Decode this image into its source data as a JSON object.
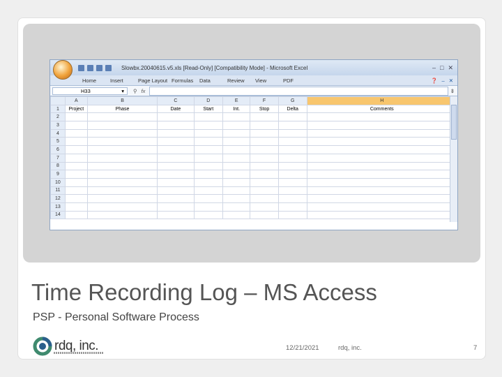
{
  "excel": {
    "window_title": "Slowbx.20040615.v5.xls [Read-Only] [Compatibility Mode] - Microsoft Excel",
    "ribbon_tabs": [
      "Home",
      "Insert",
      "Page Layout",
      "Formulas",
      "Data",
      "Review",
      "View",
      "PDF"
    ],
    "name_box": "H33",
    "fx_symbol": "fx",
    "columns": [
      "A",
      "B",
      "C",
      "D",
      "E",
      "F",
      "G",
      "H"
    ],
    "selected_column": "H",
    "header_row": [
      "Project",
      "Phase",
      "Date",
      "Start",
      "Int.",
      "Stop",
      "Delta",
      "Comments"
    ],
    "row_numbers": [
      "1",
      "2",
      "3",
      "4",
      "5",
      "6",
      "7",
      "8",
      "9",
      "10",
      "11",
      "12",
      "13",
      "14"
    ]
  },
  "slide": {
    "title": "Time Recording Log – MS Access",
    "subtitle": "PSP - Personal Software Process",
    "logo_text": "rdq, inc.",
    "date": "12/21/2021",
    "company": "rdq, inc.",
    "page": "7"
  },
  "colors": {
    "selected_column": "#f8c66e",
    "header_fill": "#e4ecf7",
    "ribbon": "#dbe5f3"
  }
}
